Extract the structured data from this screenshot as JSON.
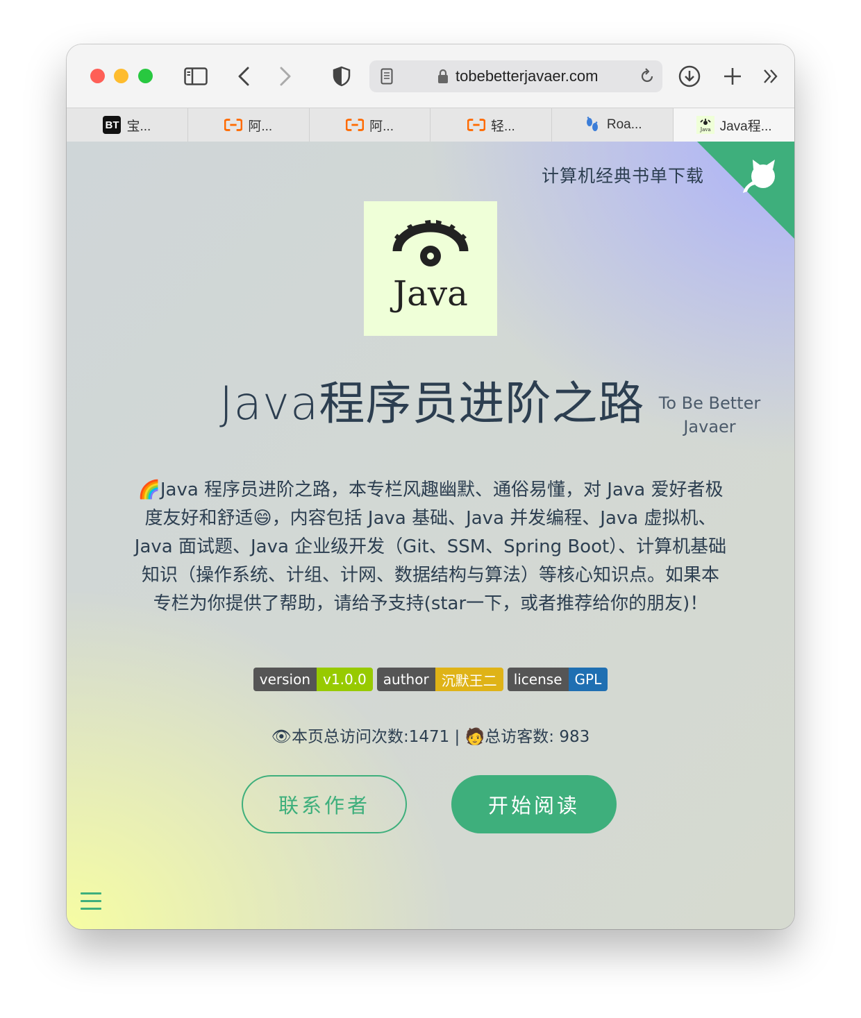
{
  "browser": {
    "url": "tobebetterjavaer.com",
    "tabs": [
      {
        "icon": "bt-icon",
        "label": "宝..."
      },
      {
        "icon": "aliyun-icon",
        "label": "阿..."
      },
      {
        "icon": "aliyun-icon",
        "label": "阿..."
      },
      {
        "icon": "aliyun-icon",
        "label": "轻..."
      },
      {
        "icon": "footprints-icon",
        "label": "Roa..."
      },
      {
        "icon": "java-logo-icon",
        "label": "Java程...",
        "active": true
      }
    ],
    "bt_favicon_text": "BT"
  },
  "page": {
    "books_link": "计算机经典书单下载",
    "logo_word": "Java",
    "title": "Java程序员进阶之路",
    "subtitle_line1": "To Be Better",
    "subtitle_line2": "Javaer",
    "description": "🌈Java 程序员进阶之路，本专栏风趣幽默、通俗易懂，对 Java 爱好者极度友好和舒适😄，内容包括 Java 基础、Java 并发编程、Java 虚拟机、Java 面试题、Java 企业级开发（Git、SSM、Spring Boot）、计算机基础知识（操作系统、计组、计网、数据结构与算法）等核心知识点。如果本专栏为你提供了帮助，请给予支持(star一下，或者推荐给你的朋友)！",
    "badges": [
      {
        "label": "version",
        "value": "v1.0.0",
        "color": "#97ca00"
      },
      {
        "label": "author",
        "value": "沉默王二",
        "color": "#dfb317"
      },
      {
        "label": "license",
        "value": "GPL",
        "color": "#1f6fb2"
      }
    ],
    "stats": "👁本页总访问次数:1471 | 🧑总访客数: 983",
    "buttons": {
      "contact": "联系作者",
      "start": "开始阅读"
    },
    "accent_color": "#3eaf7c"
  }
}
